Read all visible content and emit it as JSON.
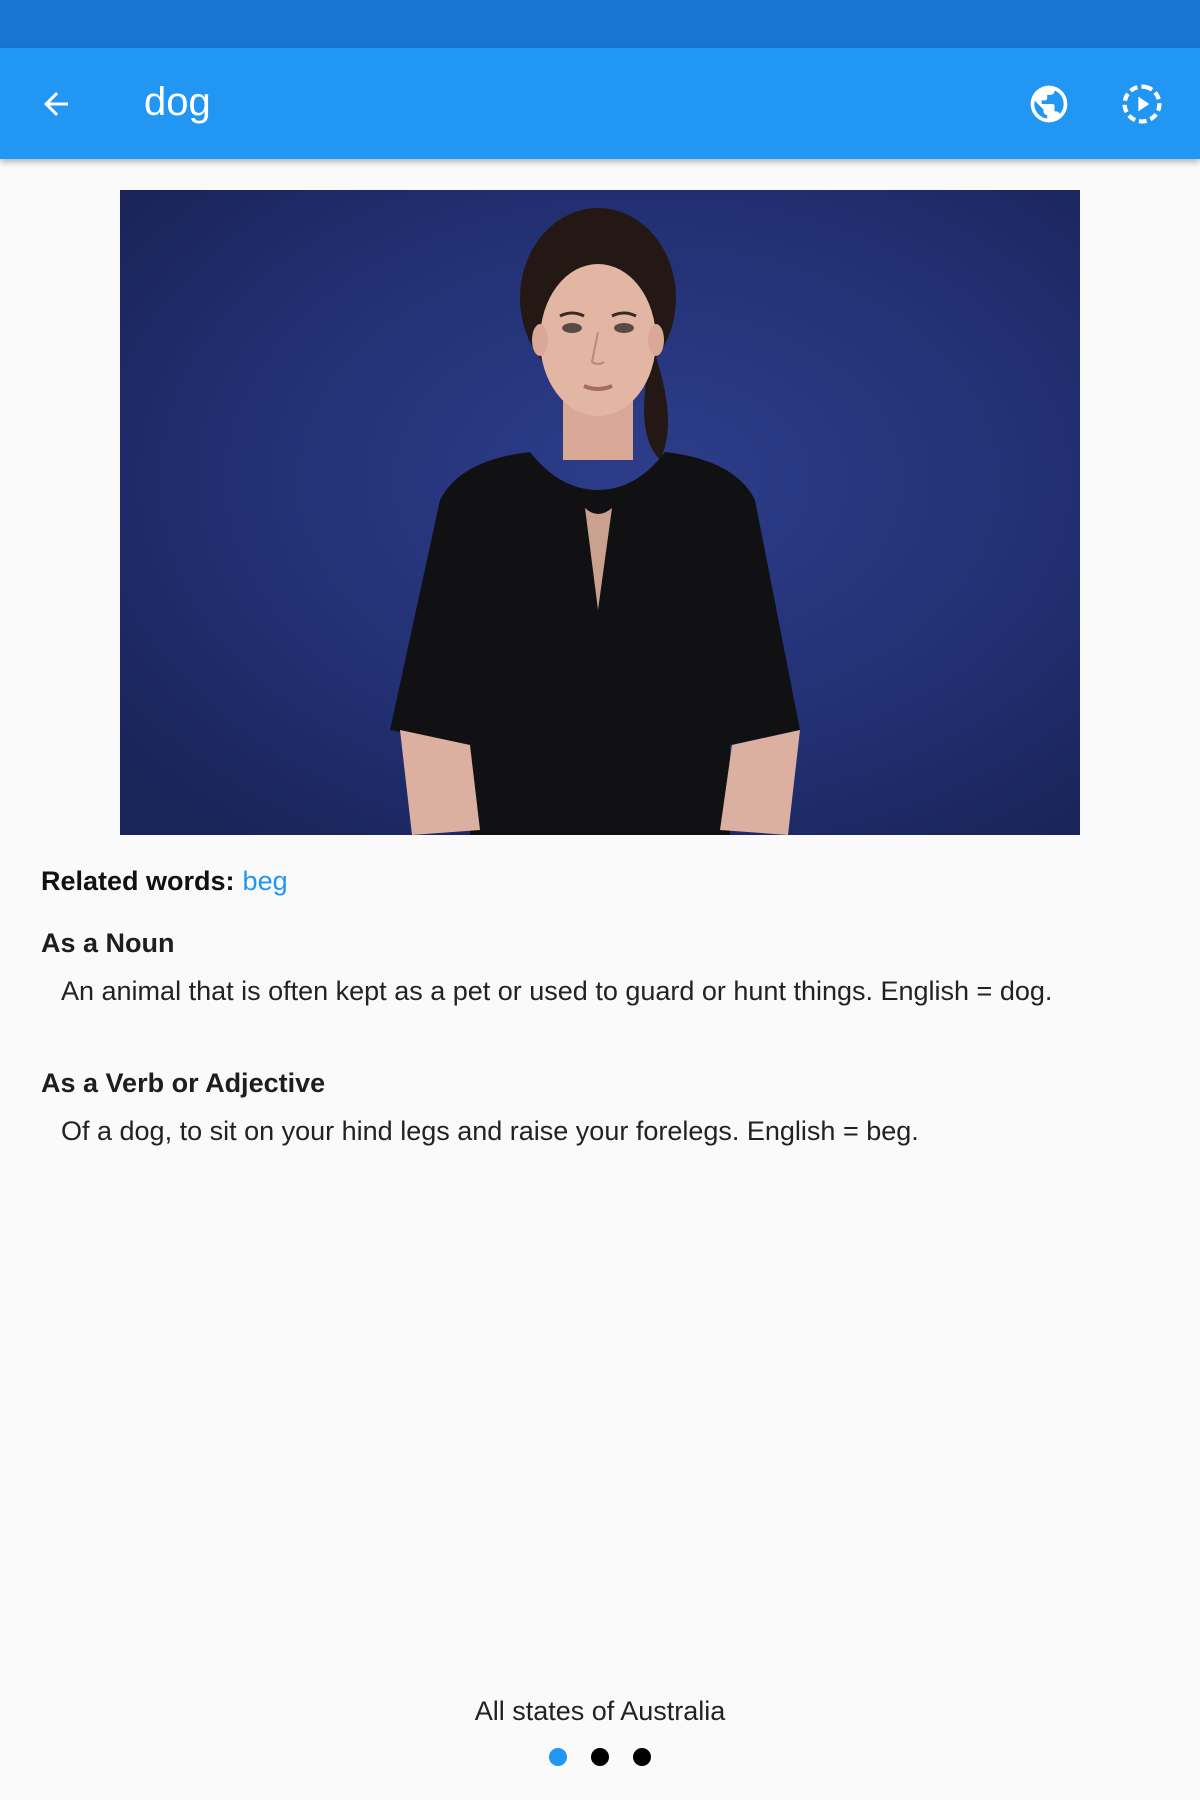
{
  "app_bar": {
    "title": "dog",
    "back_icon": "arrow-left-icon",
    "globe_icon": "globe-icon",
    "play_icon": "play-circle-dashed-icon"
  },
  "video": {
    "description_icon": "video-player"
  },
  "related": {
    "label": "Related words:",
    "words": [
      "beg"
    ]
  },
  "definitions": [
    {
      "heading": "As a Noun",
      "text": "An animal that is often kept as a pet or used to guard or hunt things. English = dog."
    },
    {
      "heading": "As a Verb or Adjective",
      "text": "Of a dog, to sit on your hind legs and raise your forelegs. English = beg."
    }
  ],
  "footer": {
    "region": "All states of Australia",
    "pages": 3,
    "active_page": 1
  },
  "colors": {
    "status_bar": "#1976d2",
    "app_bar": "#2196f3",
    "link": "#2196f3",
    "background": "#fafafa",
    "video_background": "#223073"
  }
}
